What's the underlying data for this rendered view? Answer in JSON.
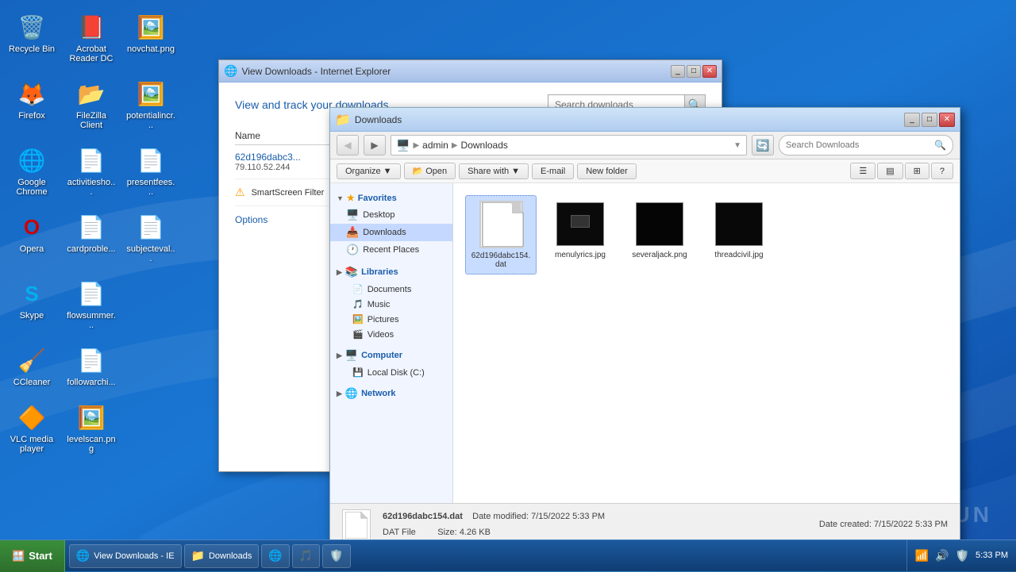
{
  "desktop": {
    "icons": [
      {
        "id": "recycle-bin",
        "label": "Recycle Bin",
        "emoji": "🗑️"
      },
      {
        "id": "acrobat",
        "label": "Acrobat Reader DC",
        "emoji": "📕"
      },
      {
        "id": "novchat",
        "label": "novchat.png",
        "emoji": "🖼️"
      },
      {
        "id": "firefox",
        "label": "Firefox",
        "emoji": "🦊"
      },
      {
        "id": "filezilla",
        "label": "FileZilla Client",
        "emoji": "📂"
      },
      {
        "id": "potentialincr",
        "label": "potentialincr...",
        "emoji": "🖼️"
      },
      {
        "id": "google-chrome",
        "label": "Google Chrome",
        "emoji": "🌐"
      },
      {
        "id": "activitiesho",
        "label": "activitiesho...",
        "emoji": "📄"
      },
      {
        "id": "presentfees",
        "label": "presentfees...",
        "emoji": "📄"
      },
      {
        "id": "opera",
        "label": "Opera",
        "emoji": "🔴"
      },
      {
        "id": "cardprob",
        "label": "cardproble...",
        "emoji": "📄"
      },
      {
        "id": "subjecteval",
        "label": "subjecteval...",
        "emoji": "📄"
      },
      {
        "id": "skype",
        "label": "Skype",
        "emoji": "💬"
      },
      {
        "id": "flowsummer",
        "label": "flowsummer...",
        "emoji": "📄"
      },
      {
        "id": "ccleaner",
        "label": "CCleaner",
        "emoji": "🧹"
      },
      {
        "id": "followarchi",
        "label": "followarchi...",
        "emoji": "📄"
      },
      {
        "id": "vlc",
        "label": "VLC media player",
        "emoji": "🔶"
      },
      {
        "id": "levelscan",
        "label": "levelscan.png",
        "emoji": "🖼️"
      }
    ]
  },
  "ie_window": {
    "title": "View Downloads - Internet Explorer",
    "header": "View and track your downloads",
    "search_placeholder": "Search downloads",
    "col_name": "Name",
    "download_name": "62d196dabc3...",
    "download_ip": "79.110.52.244",
    "smartscreen_text": "SmartScreen Filter",
    "options_label": "Options"
  },
  "explorer_window": {
    "title": "Downloads",
    "address_user": "admin",
    "address_folder": "Downloads",
    "search_placeholder": "Search Downloads",
    "toolbar": {
      "organize": "Organize",
      "open": "Open",
      "share_with": "Share with",
      "email": "E-mail",
      "new_folder": "New folder"
    },
    "sidebar": {
      "favorites_label": "Favorites",
      "favorites_items": [
        "Desktop",
        "Downloads",
        "Recent Places"
      ],
      "libraries_label": "Libraries",
      "libraries_items": [
        "Documents",
        "Music",
        "Pictures",
        "Videos"
      ],
      "computer_label": "Computer",
      "computer_items": [
        "Local Disk (C:)"
      ],
      "network_label": "Network"
    },
    "files": [
      {
        "id": "dat-file",
        "name": "62d196dabc154.dat",
        "type": "dat",
        "selected": true
      },
      {
        "id": "menu-lyrics",
        "name": "menulyrics.jpg",
        "type": "image"
      },
      {
        "id": "severaljack",
        "name": "severaljack.png",
        "type": "image"
      },
      {
        "id": "threadcivil",
        "name": "threadcivil.jpg",
        "type": "image"
      }
    ],
    "statusbar": {
      "filename": "62d196dabc154.dat",
      "date_modified_label": "Date modified:",
      "date_modified": "7/15/2022 5:33 PM",
      "date_created_label": "Date created:",
      "date_created": "7/15/2022 5:33 PM",
      "filetype": "DAT File",
      "size_label": "Size:",
      "size": "4.26 KB"
    }
  },
  "taskbar": {
    "start_label": "Start",
    "items": [
      {
        "id": "ie-task",
        "label": "View Downloads - Internet Explorer",
        "icon": "🌐"
      },
      {
        "id": "explorer-task",
        "label": "Downloads",
        "icon": "📁"
      },
      {
        "id": "chrome-task",
        "label": "",
        "icon": "🌐"
      },
      {
        "id": "media-task",
        "label": "",
        "icon": "🎵"
      },
      {
        "id": "security-task",
        "label": "",
        "icon": "🛡️"
      }
    ],
    "time": "5:33 PM"
  },
  "watermark": "ANY.RUN"
}
